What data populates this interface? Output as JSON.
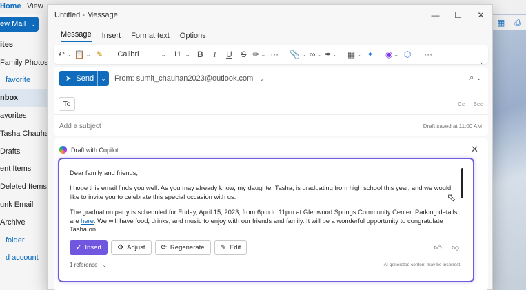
{
  "background": {
    "tabs": [
      {
        "label": "Home",
        "active": true
      },
      {
        "label": "View",
        "active": false
      }
    ],
    "new_mail_label": "ew Mail",
    "nav_items": [
      {
        "label": "ites",
        "style": "header"
      },
      {
        "label": "Family Photos",
        "style": "normal"
      },
      {
        "label": "favorite",
        "style": "link"
      },
      {
        "label": "nbox",
        "style": "selected"
      },
      {
        "label": "avorites",
        "style": "normal"
      },
      {
        "label": "Tasha Chauhan",
        "style": "normal"
      },
      {
        "label": "Drafts",
        "style": "normal"
      },
      {
        "label": "ent Items",
        "style": "normal"
      },
      {
        "label": "Deleted Items",
        "style": "normal"
      },
      {
        "label": "unk Email",
        "style": "normal"
      },
      {
        "label": "Archive",
        "style": "normal"
      },
      {
        "label": "folder",
        "style": "link"
      },
      {
        "label": "d account",
        "style": "link"
      }
    ]
  },
  "window": {
    "title": "Untitled - Message",
    "controls": {
      "minimize": "—",
      "maximize": "☐",
      "close": "✕"
    }
  },
  "menu_tabs": [
    {
      "label": "Message",
      "active": true
    },
    {
      "label": "Insert",
      "active": false
    },
    {
      "label": "Format text",
      "active": false
    },
    {
      "label": "Options",
      "active": false
    }
  ],
  "ribbon": {
    "font_name": "Calibri",
    "font_size": "11",
    "bold": "B",
    "italic": "I",
    "underline": "U",
    "strike": "S",
    "more": "···"
  },
  "compose": {
    "send_label": "Send",
    "from_label": "From: sumit_chauhan2023@outlook.com",
    "to_label": "To",
    "cc_label": "Cc",
    "bcc_label": "Bcc",
    "subject_placeholder": "Add a subject",
    "draft_saved": "Draft saved at 11:00 AM"
  },
  "copilot": {
    "title": "Draft with Copilot",
    "paragraphs": [
      "Dear family and friends,",
      "I hope this email finds you well. As you may already know, my daughter Tasha, is graduating from high school this year, and we would like to invite you to celebrate this special occasion with us."
    ],
    "para3_before_link": "The graduation party is scheduled for Friday, April 15, 2023, from 6pm to 11pm at Glenwood Springs Community Center. Parking details are ",
    "para3_link": "here",
    "para3_after_link": ". We will have food, drinks, and music to enjoy with our friends and family. It will be a wonderful opportunity to congratulate Tasha on",
    "buttons": {
      "insert": "Insert",
      "adjust": "Adjust",
      "regenerate": "Regenerate",
      "edit": "Edit"
    },
    "reference": "1 reference",
    "disclaimer": "AI-generated content may be incorrect."
  },
  "colors": {
    "accent": "#0f6cbd",
    "copilot_purple": "#7156df",
    "copilot_border": "#6a5fd8"
  }
}
